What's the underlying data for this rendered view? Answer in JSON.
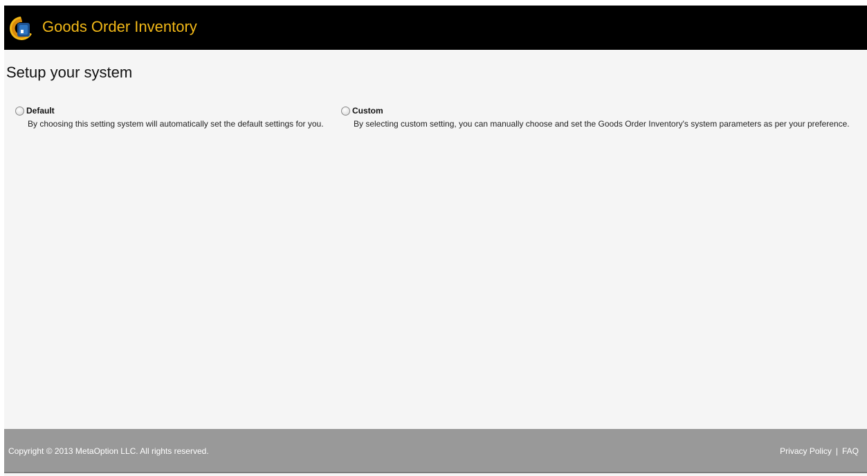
{
  "header": {
    "app_title": "Goods Order Inventory",
    "logo_icon": "goods-order-inventory-logo",
    "accent_color": "#f2b817"
  },
  "page": {
    "title": "Setup your system"
  },
  "options": [
    {
      "label": "Default",
      "description": "By choosing this setting system will automatically set the default settings for you.",
      "selected": false
    },
    {
      "label": "Custom",
      "description": "By selecting custom setting, you can manually choose and set the Goods Order Inventory's system parameters as per your preference.",
      "selected": false
    }
  ],
  "footer": {
    "copyright": "Copyright © 2013 MetaOption LLC. All rights reserved.",
    "privacy_link": "Privacy Policy",
    "separator": "|",
    "faq_link": "FAQ"
  }
}
